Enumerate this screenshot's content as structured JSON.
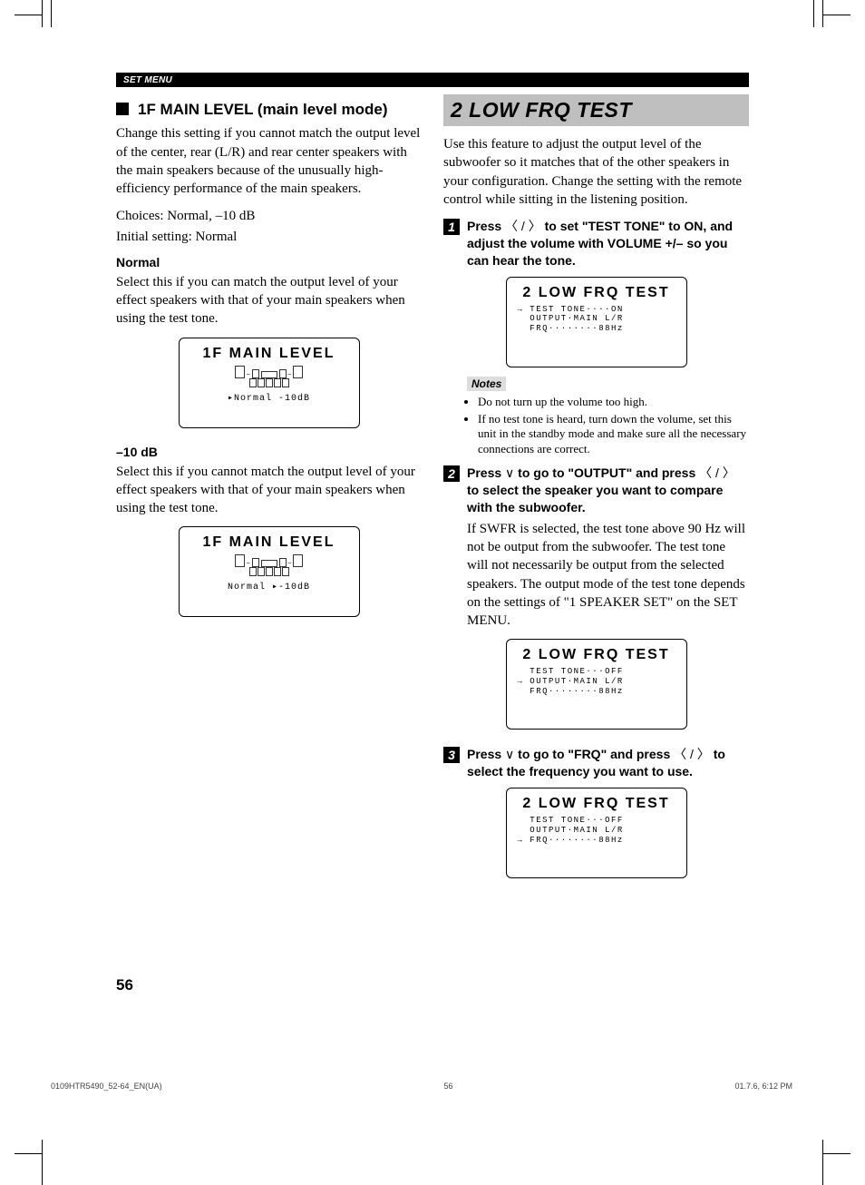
{
  "header": {
    "label": "SET MENU"
  },
  "left": {
    "section_title": "1F MAIN LEVEL (main level mode)",
    "intro": "Change this setting if you cannot match the output level of the center, rear (L/R) and rear center speakers with the main speakers because of the unusually high-efficiency performance of the main speakers.",
    "choices": "Choices: Normal, –10 dB",
    "initial": "Initial setting: Normal",
    "normal_head": "Normal",
    "normal_body": "Select this if you can match the output level of your effect speakers with that of your main speakers when using the test tone.",
    "display1": {
      "title": "1F MAIN LEVEL",
      "footer": "▸Normal  -10dB"
    },
    "minus10_head": "–10 dB",
    "minus10_body": "Select this if you cannot match the output level of your effect speakers with that of your main speakers when using the test tone.",
    "display2": {
      "title": "1F MAIN LEVEL",
      "footer": " Normal ▸-10dB"
    }
  },
  "right": {
    "heading": "2 LOW FRQ TEST",
    "intro": "Use this feature to adjust the output level of the subwoofer so it matches that of the other speakers in your configuration. Change the setting with the remote control while sitting in the listening position.",
    "step1": {
      "num": "1",
      "text_a": "Press ",
      "text_b": " to set \"TEST TONE\" to ON, and adjust the volume with VOLUME +/– so you can hear the tone."
    },
    "display1": {
      "title": "2 LOW FRQ TEST",
      "lines": "→ TEST TONE····ON\n  OUTPUT·MAIN L/R\n  FRQ········88Hz"
    },
    "notes_label": "Notes",
    "notes": [
      "Do not turn up the volume too high.",
      "If no test tone is heard, turn down the volume, set this unit in the standby mode and make sure all the necessary connections are correct."
    ],
    "step2": {
      "num": "2",
      "text_a": "Press ",
      "text_b": " to go to \"OUTPUT\" and press ",
      "text_c": " to select the speaker you want to compare with the subwoofer.",
      "body": "If SWFR is selected, the test tone above 90 Hz will not be output from the subwoofer. The test tone will not necessarily be output from the selected speakers. The output mode of the test tone depends on the settings of \"1 SPEAKER SET\" on the SET MENU."
    },
    "display2": {
      "title": "2 LOW FRQ TEST",
      "lines": "  TEST TONE···OFF\n→ OUTPUT·MAIN L/R\n  FRQ········88Hz"
    },
    "step3": {
      "num": "3",
      "text_a": "Press ",
      "text_b": " to go to \"FRQ\" and press ",
      "text_c": " to select the frequency you want to use."
    },
    "display3": {
      "title": "2 LOW FRQ TEST",
      "lines": "  TEST TONE···OFF\n  OUTPUT·MAIN L/R\n→ FRQ········88Hz"
    }
  },
  "glyphs": {
    "leftright": "〈 / 〉",
    "down": "∨"
  },
  "page_number": "56",
  "footer": {
    "left": "0109HTR5490_52-64_EN(UA)",
    "center": "56",
    "right": "01.7.6, 6:12 PM"
  }
}
